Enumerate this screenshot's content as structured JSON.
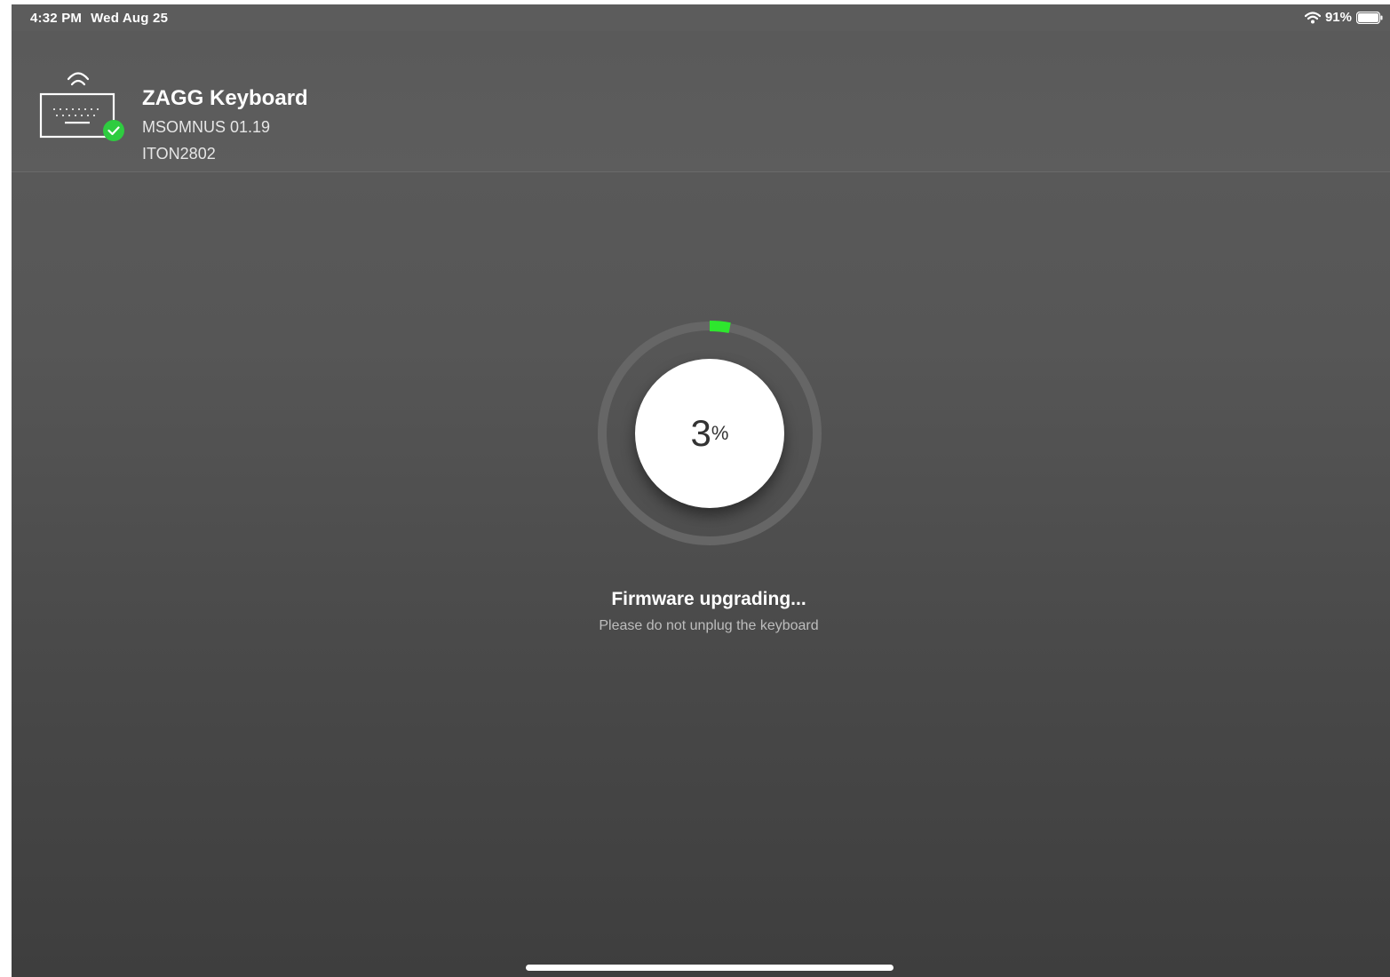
{
  "status_bar": {
    "time": "4:32 PM",
    "date": "Wed Aug 25",
    "battery_percent_label": "91%",
    "wifi_icon": "wifi-icon",
    "battery_icon": "battery-icon"
  },
  "device": {
    "name": "ZAGG Keyboard",
    "firmware": "MSOMNUS 01.19",
    "serial": "ITON2802",
    "icon": "keyboard-wireless-icon",
    "connected_badge_icon": "check-icon",
    "badge_color": "#2ecc40"
  },
  "progress": {
    "value": "3",
    "unit": "%",
    "fraction": 0.03,
    "accent_color": "#2ee62e",
    "track_color": "#666666"
  },
  "message": {
    "title": "Firmware upgrading...",
    "subtitle": "Please do not unplug the keyboard"
  }
}
